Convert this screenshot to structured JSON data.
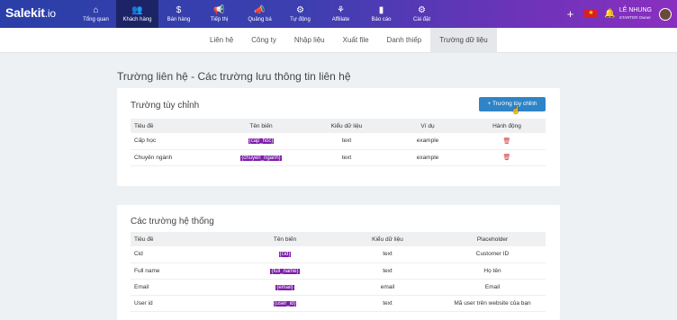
{
  "brand": {
    "logo": "Salekit",
    "logo_suffix": ".io"
  },
  "nav": [
    {
      "icon": "⌂",
      "label": "Tổng quan"
    },
    {
      "icon": "👥",
      "label": "Khách hàng"
    },
    {
      "icon": "$",
      "label": "Bán hàng"
    },
    {
      "icon": "📢",
      "label": "Tiếp thị"
    },
    {
      "icon": "📣",
      "label": "Quảng bá"
    },
    {
      "icon": "⚙",
      "label": "Tự động"
    },
    {
      "icon": "⚘",
      "label": "Affiliate"
    },
    {
      "icon": "▮",
      "label": "Báo cáo"
    },
    {
      "icon": "⚙",
      "label": "Cài đặt"
    }
  ],
  "user": {
    "name": "LÊ NHUNG",
    "plan": "STARTER",
    "role": "Owner"
  },
  "subnav": [
    "Liên hệ",
    "Công ty",
    "Nhập liệu",
    "Xuất file",
    "Danh thiếp",
    "Trường dữ liệu"
  ],
  "page_title": "Trường liên hệ - Các trường lưu thông tin liên hệ",
  "custom": {
    "heading": "Trường tùy chỉnh",
    "add_label": "+ Trường tùy chỉnh",
    "headers": [
      "Tiêu đề",
      "Tên biến",
      "Kiểu dữ liệu",
      "Ví dụ",
      "Hành động"
    ],
    "rows": [
      {
        "title": "Cấp học",
        "var": "{cap_hoc}",
        "type": "text",
        "example": "example"
      },
      {
        "title": "Chuyên ngành",
        "var": "{chuyen_nganh}",
        "type": "text",
        "example": "example"
      }
    ]
  },
  "system": {
    "heading": "Các trường hệ thống",
    "headers": [
      "Tiêu đề",
      "Tên biến",
      "Kiểu dữ liệu",
      "Placeholder"
    ],
    "rows": [
      {
        "title": "Cid",
        "var": "{cid}",
        "type": "text",
        "placeholder": "Customer ID"
      },
      {
        "title": "Full name",
        "var": "{full_name}",
        "type": "text",
        "placeholder": "Họ tên"
      },
      {
        "title": "Email",
        "var": "{email}",
        "type": "email",
        "placeholder": "Email"
      },
      {
        "title": "User id",
        "var": "{user_id}",
        "type": "text",
        "placeholder": "Mã user trên website của bạn"
      }
    ]
  }
}
